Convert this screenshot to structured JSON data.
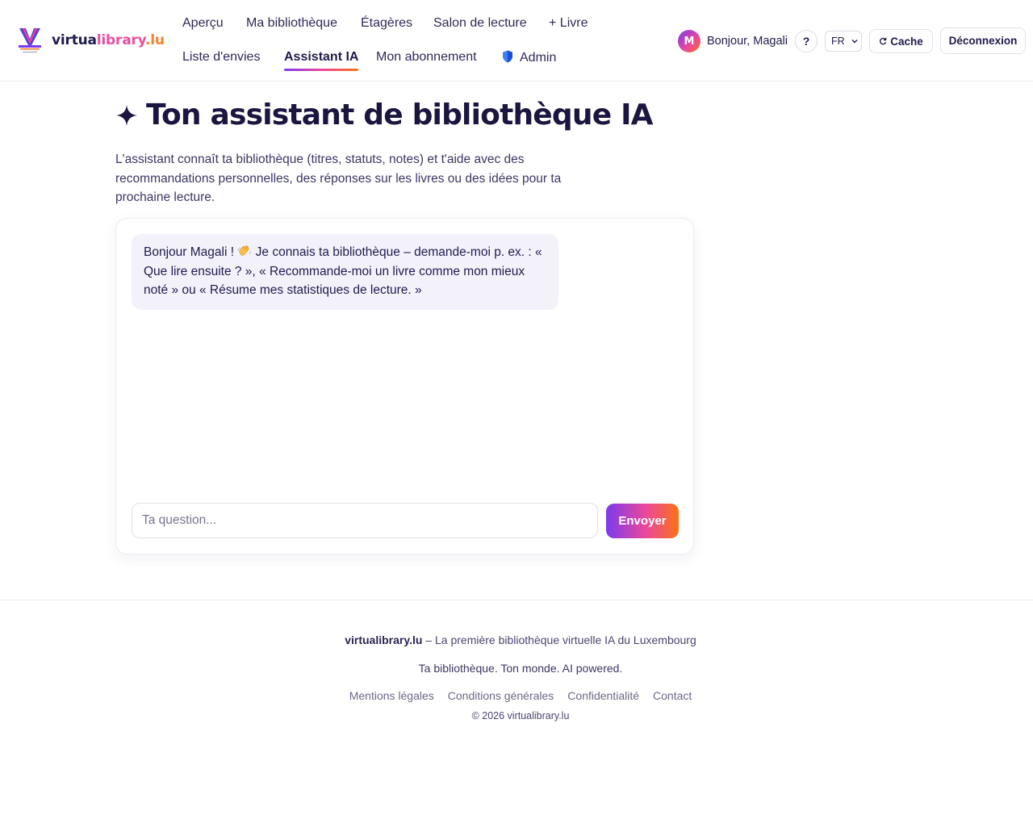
{
  "brand": {
    "name_part1": "virtua",
    "name_part2": "library",
    "name_part3": ".lu"
  },
  "nav": {
    "items": [
      {
        "label": "Aperçu"
      },
      {
        "label": "Ma bibliothèque"
      },
      {
        "label": "Étagères"
      },
      {
        "label": "Salon de lecture"
      },
      {
        "label": "+ Livre"
      },
      {
        "label": "Liste d'envies"
      },
      {
        "label": "Assistant IA",
        "active": true
      },
      {
        "label": "Mon abonnement"
      },
      {
        "label": "Admin",
        "icon": "shield-icon"
      }
    ]
  },
  "user": {
    "initial": "M",
    "greeting": "Bonjour, Magali"
  },
  "header_actions": {
    "help_label": "?",
    "language": "FR",
    "cache_label": "Cache",
    "logout_label": "Déconnexion"
  },
  "main": {
    "title": "Ton assistant de bibliothèque IA",
    "title_icon": "sparkle-icon",
    "intro": "L'assistant connaît ta bibliothèque (titres, statuts, notes) et t'aide avec des recommandations personnelles, des réponses sur les livres ou des idées pour ta prochaine lecture."
  },
  "chat": {
    "messages": [
      {
        "role": "assistant",
        "text_before_icon": "Bonjour Magali !",
        "icon": "waving-hand-icon",
        "text_after_icon": "Je connais ta bibliothèque – demande-moi p. ex. : « Que lire ensuite ? », « Recommande-moi un livre comme mon mieux noté » ou « Résume mes statistiques de lecture. »"
      }
    ],
    "input_placeholder": "Ta question...",
    "input_value": "",
    "send_label": "Envoyer"
  },
  "footer": {
    "brand": "virtualibrary.lu",
    "tagline": " – La première bibliothèque virtuelle IA du Luxembourg",
    "slogan": "Ta bibliothèque. Ton monde. AI powered.",
    "links": [
      {
        "label": "Mentions légales"
      },
      {
        "label": "Conditions générales"
      },
      {
        "label": "Confidentialité"
      },
      {
        "label": "Contact"
      }
    ],
    "copyright": "© 2026 virtualibrary.lu"
  },
  "colors": {
    "accent_purple": "#7c3aed",
    "accent_pink": "#ec4899",
    "accent_orange": "#f97316",
    "text_dark": "#1f1b4d"
  }
}
